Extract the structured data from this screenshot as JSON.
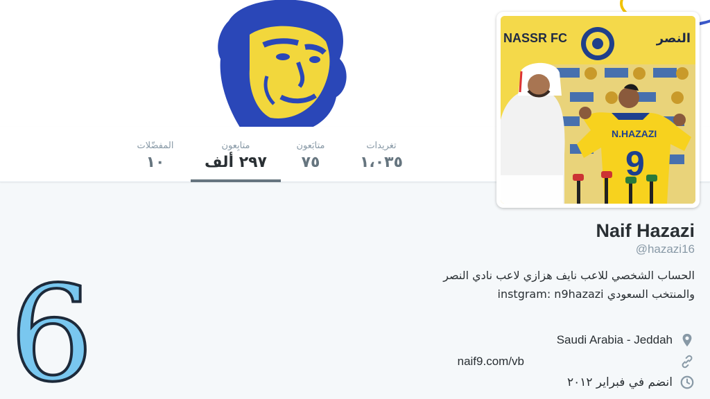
{
  "profile": {
    "name": "Naif Hazazi",
    "handle": "@hazazi16",
    "bio": "الحساب الشخصي للاعب نايف هزازي لاعب نادي النصر والمنتخب السعودي instgram: n9hazazi",
    "location": "Saudi Arabia - Jeddah",
    "url": "naif9.com/vb",
    "joined": "انضم في فبراير ٢٠١٢"
  },
  "stats": {
    "tweets": {
      "label": "تغريدات",
      "value": "١،٠٣٥"
    },
    "following": {
      "label": "متابَعون",
      "value": "٧٥"
    },
    "followers": {
      "label": "متابِعون",
      "value": "٢٩٧ ألف"
    },
    "favorites": {
      "label": "المفضّلات",
      "value": "١٠"
    }
  },
  "avatar_text": {
    "club_en": "NASSR FC",
    "club_ar": "النصر",
    "shirt_name": "N.HAZAZI",
    "shirt_number": "9"
  },
  "overlay": {
    "number": "6"
  },
  "icons": {
    "location": "map-pin-icon",
    "url": "link-icon",
    "joined": "clock-icon"
  },
  "colors": {
    "accent_yellow": "#f3d23a",
    "accent_blue": "#3a58c9",
    "text_primary": "#292f33",
    "text_secondary": "#8899a6",
    "overlay_number": "#79c7ef"
  }
}
